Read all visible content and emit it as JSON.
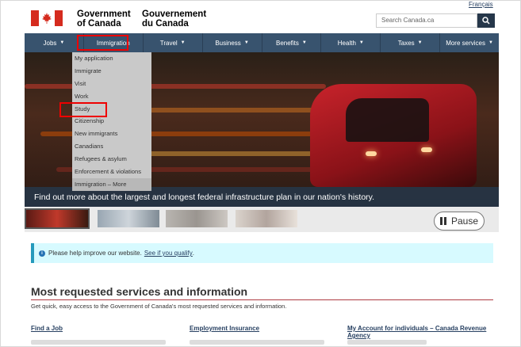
{
  "header": {
    "language_toggle": "Français",
    "signature_en_line1": "Government",
    "signature_en_line2": "of Canada",
    "signature_fr_line1": "Gouvernement",
    "signature_fr_line2": "du Canada",
    "search_placeholder": "Search Canada.ca"
  },
  "nav": {
    "items": [
      {
        "label": "Jobs"
      },
      {
        "label": "Immigration"
      },
      {
        "label": "Travel"
      },
      {
        "label": "Business"
      },
      {
        "label": "Benefits"
      },
      {
        "label": "Health"
      },
      {
        "label": "Taxes"
      },
      {
        "label": "More services"
      }
    ]
  },
  "dropdown": {
    "items": [
      "My application",
      "Immigrate",
      "Visit",
      "Work",
      "Study",
      "Citizenship",
      "New immigrants",
      "Canadians",
      "Refugees & asylum",
      "Enforcement & violations",
      "Immigration – More"
    ]
  },
  "hero": {
    "caption": "Find out more about the largest and longest federal infrastructure plan in our nation's history."
  },
  "carousel": {
    "pause_label": "Pause"
  },
  "notice": {
    "text": "Please help improve our website.",
    "link": "See if you qualify",
    "suffix": "."
  },
  "most_requested": {
    "title": "Most requested services and information",
    "subtitle": "Get quick, easy access to the Government of Canada's most requested services and information.",
    "links": [
      {
        "label": "Find a Job"
      },
      {
        "label": "Employment Insurance"
      },
      {
        "label": "My Account for individuals – Canada Revenue Agency"
      }
    ]
  },
  "colors": {
    "nav_bg": "#38536e",
    "highlight": "#e00000",
    "flag_red": "#d52b1e",
    "rule": "#af3c43"
  }
}
